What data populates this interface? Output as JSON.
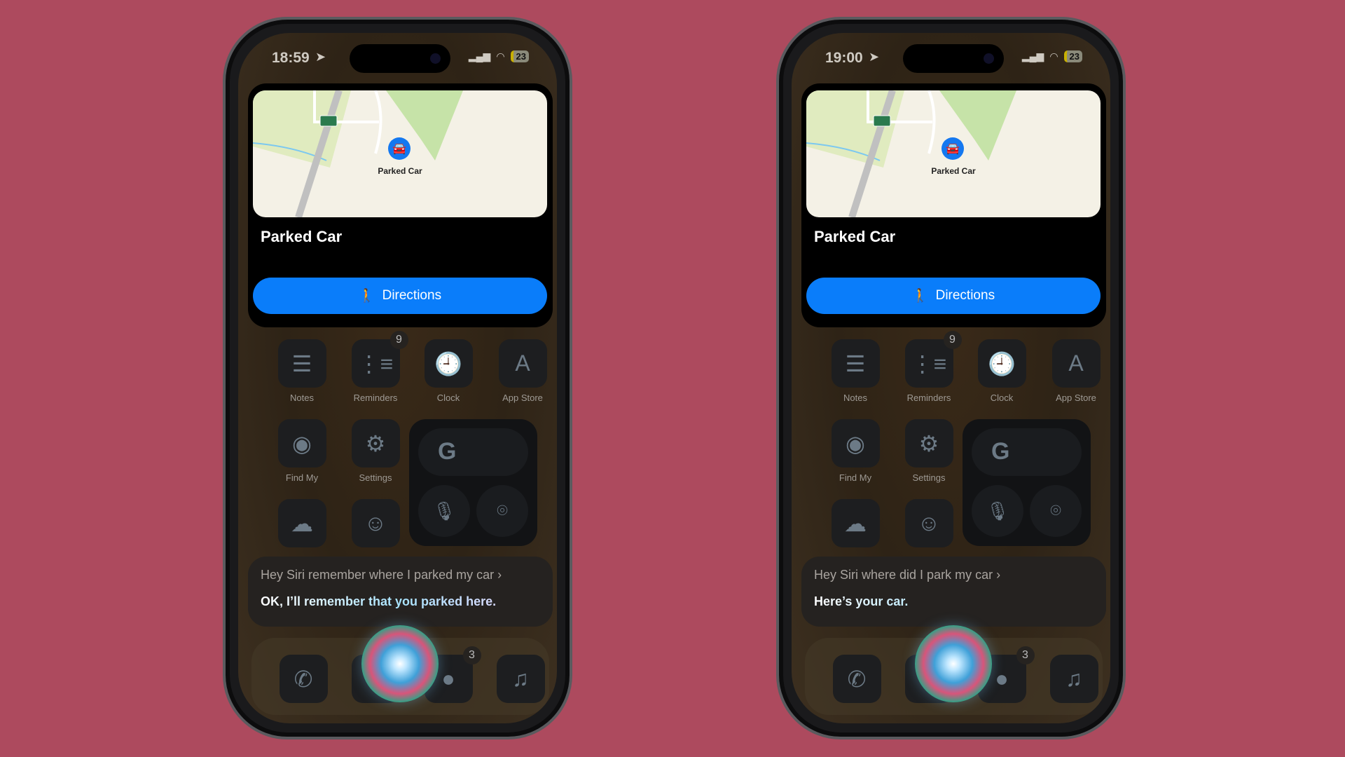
{
  "phones": [
    {
      "time": "18:59",
      "battery": "23",
      "card_title": "Parked Car",
      "map_pin_label": "Parked Car",
      "directions_label": "Directions",
      "apps_row1": [
        {
          "label": "Notes",
          "icon": "notes-icon"
        },
        {
          "label": "Reminders",
          "icon": "reminders-icon",
          "badge": "9"
        },
        {
          "label": "Clock",
          "icon": "clock-icon"
        },
        {
          "label": "App Store",
          "icon": "app-store-icon"
        }
      ],
      "apps_row2": [
        {
          "label": "Find My",
          "icon": "find-my-icon"
        },
        {
          "label": "Settings",
          "icon": "settings-icon"
        }
      ],
      "apps_row3": [
        {
          "icon": "weather-icon"
        },
        {
          "icon": "faceapp-icon"
        }
      ],
      "siri_query": "Hey Siri remember where I parked my car",
      "siri_response": "OK, I’ll remember that you parked here.",
      "dock": [
        {
          "icon": "phone-icon"
        },
        {
          "icon": "safari-icon"
        },
        {
          "icon": "messages-icon",
          "badge": "3"
        },
        {
          "icon": "music-icon"
        }
      ]
    },
    {
      "time": "19:00",
      "battery": "23",
      "card_title": "Parked Car",
      "map_pin_label": "Parked Car",
      "directions_label": "Directions",
      "apps_row1": [
        {
          "label": "Notes",
          "icon": "notes-icon"
        },
        {
          "label": "Reminders",
          "icon": "reminders-icon",
          "badge": "9"
        },
        {
          "label": "Clock",
          "icon": "clock-icon"
        },
        {
          "label": "App Store",
          "icon": "app-store-icon"
        }
      ],
      "apps_row2": [
        {
          "label": "Find My",
          "icon": "find-my-icon"
        },
        {
          "label": "Settings",
          "icon": "settings-icon"
        }
      ],
      "apps_row3": [
        {
          "icon": "weather-icon"
        },
        {
          "icon": "faceapp-icon"
        }
      ],
      "siri_query": "Hey Siri where did I park my car",
      "siri_response": "Here’s your car.",
      "dock": [
        {
          "icon": "phone-icon"
        },
        {
          "icon": "safari-icon"
        },
        {
          "icon": "messages-icon",
          "badge": "3"
        },
        {
          "icon": "music-icon"
        }
      ]
    }
  ],
  "colors": {
    "background": "#ad4a5e",
    "accent": "#0a7dfa"
  }
}
